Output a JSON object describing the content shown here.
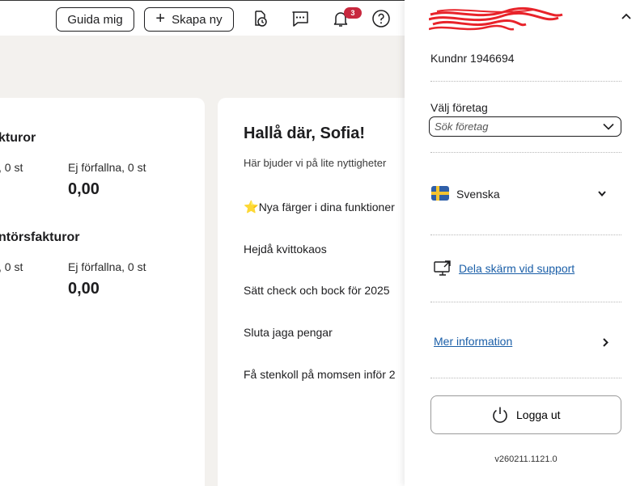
{
  "header": {
    "guide_label": "Guida mig",
    "create_label": "Skapa ny",
    "notification_count": "3"
  },
  "customer_invoices": {
    "title": "kturor",
    "overdue_label": ", 0 st",
    "not_due_label": "Ej förfallna, 0 st",
    "not_due_amount": "0,00"
  },
  "supplier_invoices": {
    "title": "ntörsfakturor",
    "overdue_label": ", 0 st",
    "not_due_label": "Ej förfallna, 0 st",
    "not_due_amount": "0,00"
  },
  "news": {
    "greeting": "Hallå där, Sofia!",
    "intro": "Här bjuder vi på lite nyttigheter",
    "items": [
      {
        "icon": "star-icon",
        "text": "Nya färger i dina funktioner"
      },
      {
        "text": "Hejdå kvittokaos"
      },
      {
        "text": "Sätt check och bock för 2025"
      },
      {
        "text": "Sluta jaga pengar"
      },
      {
        "text": "Få stenkoll på momsen inför 2"
      }
    ]
  },
  "user_panel": {
    "customer_number": "Kundnr 1946694",
    "company_label": "Välj företag",
    "company_placeholder": "Sök företag",
    "language": "Svenska",
    "share_screen": "Dela skärm vid support",
    "more_info": "Mer information",
    "logout": "Logga ut",
    "version": "v260211.1121.0"
  },
  "colors": {
    "link": "#1b5fa8",
    "badge": "#c8283e",
    "background": "#f3f1ee"
  }
}
